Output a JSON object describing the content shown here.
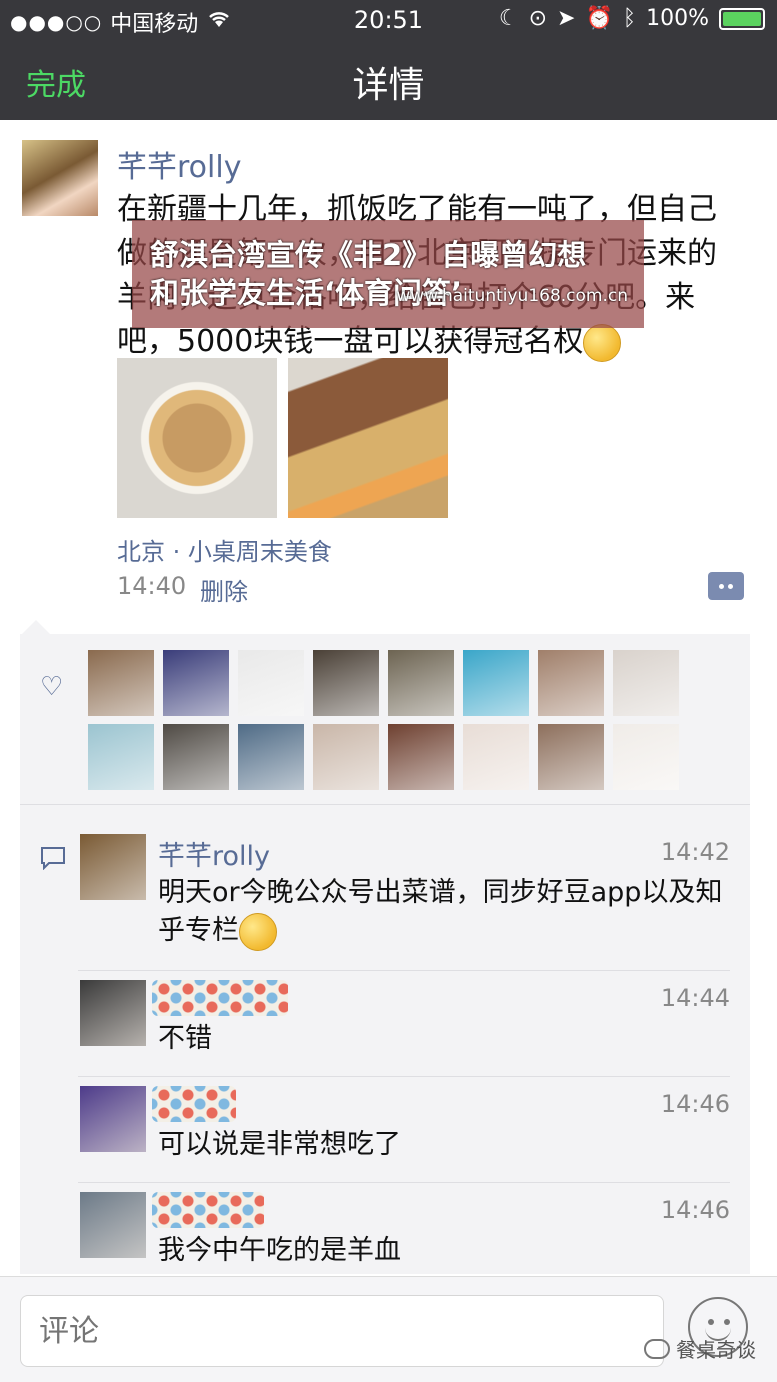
{
  "status_bar": {
    "signal": "●●●○○",
    "carrier": "中国移动",
    "time": "20:51",
    "battery": "100%",
    "battery_level": 1.0
  },
  "nav": {
    "done_label": "完成",
    "title": "详情"
  },
  "post": {
    "author": "芊芊rolly",
    "text": "在新疆十几年，抓饭吃了能有一吨了，但自己做的还是第一次，用了北京阿凡提专门运来的羊肉，还算合格吧，给自己打个60分吧。来吧，5000块钱一盘可以获得冠名权",
    "location": "北京 · 小桌周末美食",
    "time": "14:40",
    "delete_label": "删除"
  },
  "overlay": {
    "line1": "舒淇台湾宣传《非2》 自曝曾幻想",
    "line2": "和张学友生活‘体育问答’",
    "url": "www.haituntiyu168.com.cn"
  },
  "likes": {
    "count": 16,
    "colors": [
      "#8a6a4e",
      "#3a3d7a",
      "#e9e9e9",
      "#4a4036",
      "#6d6452",
      "#3aa6c9",
      "#a07f6a",
      "#d9d2cc",
      "#9bc4d0",
      "#4f4a44",
      "#4f6b86",
      "#c9b6a8",
      "#6e4030",
      "#e8ddd6",
      "#8d6f5c",
      "#f0ece8"
    ]
  },
  "comments": [
    {
      "name": "芊芊rolly",
      "time": "14:42",
      "text": "明天or今晚公众号出菜谱，同步好豆app以及知乎专栏",
      "avatar_color": "#7a5a34"
    },
    {
      "name": "",
      "time": "14:44",
      "text": "不错",
      "avatar_color": "#3a3a3a"
    },
    {
      "name": "",
      "time": "14:46",
      "text": "可以说是非常想吃了",
      "avatar_color": "#4d3b8a"
    },
    {
      "name": "",
      "time": "14:46",
      "text": "我今中午吃的是羊血",
      "avatar_color": "#6c7a88"
    }
  ],
  "input": {
    "placeholder": "评论"
  },
  "watermark": {
    "text": "餐桌奇谈"
  }
}
